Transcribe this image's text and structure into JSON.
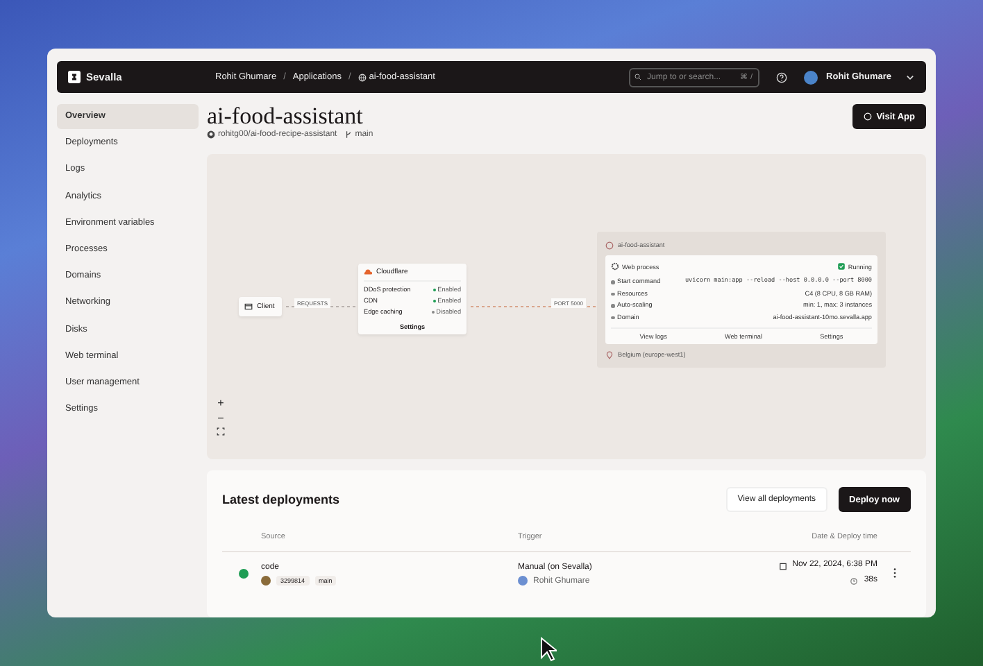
{
  "topbar": {
    "brand": "Sevalla",
    "breadcrumbs": [
      "Rohit Ghumare",
      "Applications",
      "ai-food-assistant"
    ],
    "separator": "/",
    "search": {
      "placeholder": "Jump to or search...",
      "shortcut": "⌘ /"
    },
    "user": "Rohit Ghumare"
  },
  "sidebar": {
    "items": [
      {
        "label": "Overview",
        "selected": true
      },
      {
        "label": "Deployments",
        "selected": false
      },
      {
        "label": "Logs",
        "selected": false
      },
      {
        "label": "Analytics",
        "selected": false
      },
      {
        "label": "Environment variables",
        "selected": false
      },
      {
        "label": "Processes",
        "selected": false
      },
      {
        "label": "Domains",
        "selected": false
      },
      {
        "label": "Networking",
        "selected": false
      },
      {
        "label": "Disks",
        "selected": false
      },
      {
        "label": "Web terminal",
        "selected": false
      },
      {
        "label": "User management",
        "selected": false
      },
      {
        "label": "Settings",
        "selected": false
      }
    ]
  },
  "header": {
    "title": "ai-food-assistant",
    "repo": "rohitg00/ai-food-recipe-assistant",
    "branch": "main",
    "button": "Visit App"
  },
  "diagram": {
    "client": "Client",
    "requests_label": "REQUESTS",
    "port_label": "PORT 5000",
    "cloudflare": {
      "title": "Cloudflare",
      "features": [
        {
          "name": "DDoS protection",
          "status": "Enabled",
          "enabled": true
        },
        {
          "name": "CDN",
          "status": "Enabled",
          "enabled": true
        },
        {
          "name": "Edge caching",
          "status": "Disabled",
          "enabled": false
        }
      ],
      "button": "Settings"
    },
    "app": {
      "name": "ai-food-assistant",
      "process": "Web process",
      "status": "Running",
      "details": [
        {
          "label": "Start command",
          "value": "uvicorn main:app --reload --host 0.0.0.0 --port 8000",
          "kind": "code"
        },
        {
          "label": "Resources",
          "value": "C4 (8 CPU, 8 GB RAM)",
          "kind": "text"
        },
        {
          "label": "Auto-scaling",
          "value": "min: 1, max: 3 instances",
          "kind": "text"
        },
        {
          "label": "Domain",
          "value": "ai-food-assistant-10mo.sevalla.app",
          "kind": "text"
        }
      ],
      "buttons": [
        "View logs",
        "Web terminal",
        "Settings"
      ],
      "location": "Belgium (europe-west1)"
    },
    "zoom": [
      "+",
      "−"
    ]
  },
  "deployments": {
    "title": "Latest deployments",
    "buttons": [
      "View all deployments",
      "Deploy now"
    ],
    "columns": [
      "Source",
      "Trigger",
      "Date & Deploy time"
    ],
    "rows": [
      {
        "source": "code",
        "commit": "3299814",
        "branch": "main",
        "trigger": "Manual (on Sevalla)",
        "user": "Rohit Ghumare",
        "date": "Nov 22, 2024, 6:38 PM",
        "duration": "38s",
        "color": "#1f9d55"
      }
    ]
  }
}
